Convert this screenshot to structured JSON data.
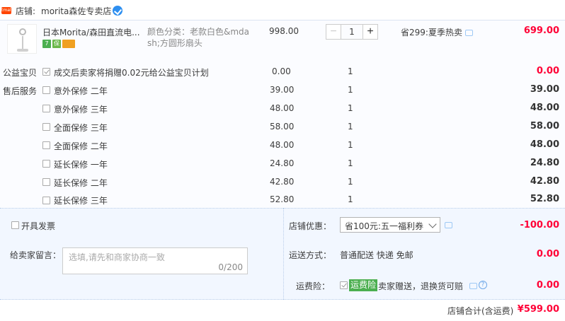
{
  "shop": {
    "tag": "tmall",
    "label": "店铺:",
    "name": "morita森佐专卖店",
    "verified_icon": "verified-badge-icon"
  },
  "item": {
    "thumb_icon": "fan-product-icon",
    "title": "日本Morita/森田直流电...",
    "badges": [
      "7",
      "保",
      "card"
    ],
    "sku": "颜色分类：老款白色&mdash;方圆形扇头",
    "unit_price": "998.00",
    "quantity": "1",
    "minus": "−",
    "plus": "+",
    "promo": "省299:夏季热卖",
    "total": "699.00"
  },
  "charity": {
    "label": "公益宝贝",
    "text": "成交后卖家将捐赠0.02元给公益宝贝计划",
    "price": "0.00",
    "qty": "1",
    "total": "0.00"
  },
  "services": {
    "label": "售后服务",
    "rows": [
      {
        "name": "意外保修 二年",
        "price": "39.00",
        "qty": "1",
        "total": "39.00"
      },
      {
        "name": "意外保修 三年",
        "price": "48.00",
        "qty": "1",
        "total": "48.00"
      },
      {
        "name": "全面保修 三年",
        "price": "58.00",
        "qty": "1",
        "total": "58.00"
      },
      {
        "name": "全面保修 二年",
        "price": "48.00",
        "qty": "1",
        "total": "48.00"
      },
      {
        "name": "延长保修 一年",
        "price": "24.80",
        "qty": "1",
        "total": "24.80"
      },
      {
        "name": "延长保修 二年",
        "price": "42.80",
        "qty": "1",
        "total": "42.80"
      },
      {
        "name": "延长保修 三年",
        "price": "52.80",
        "qty": "1",
        "total": "52.80"
      }
    ]
  },
  "invoice": {
    "label": "开具发票"
  },
  "message": {
    "label": "给卖家留言：",
    "placeholder": "选填,请先和商家协商一致",
    "count": "0/200"
  },
  "discount": {
    "label": "店铺优惠：",
    "selected": "省100元:五一福利券",
    "total": "-100.00"
  },
  "shipping": {
    "label": "运送方式：",
    "method": "普通配送 快递 免邮",
    "total": "0.00"
  },
  "insurance": {
    "label": "运费险：",
    "tag": "运费险",
    "desc": "卖家赠送，退换货可赔",
    "help": "?",
    "total": "0.00"
  },
  "shop_total": {
    "label": "店铺合计(含运费)",
    "value": "¥599.00"
  },
  "colors": {
    "price_red": "#ff0036",
    "bottom_bg": "#f2f7ff",
    "order_bg": "#fbfcff",
    "ins_green": "#4caf50"
  }
}
